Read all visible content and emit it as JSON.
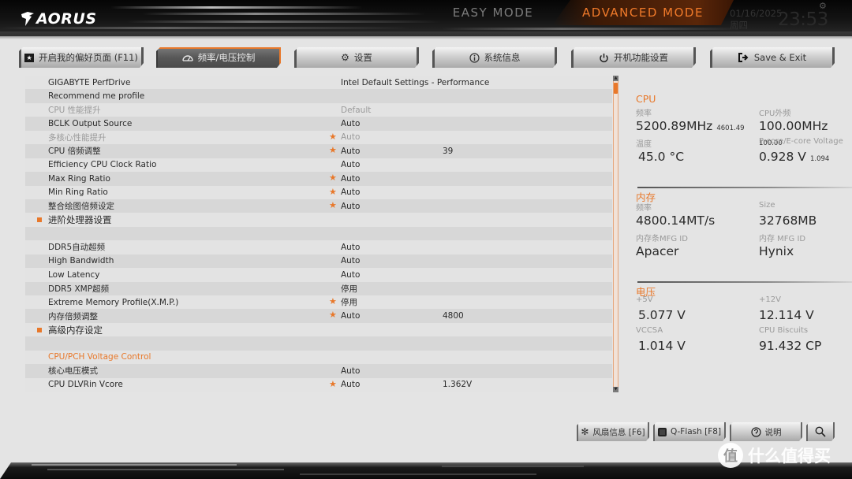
{
  "header": {
    "logo": "AORUS",
    "easy_mode": "EASY MODE",
    "advanced_mode": "ADVANCED MODE",
    "date": "01/16/2025",
    "weekday": "周四",
    "time": "23:53"
  },
  "tabs": [
    {
      "label": "开启我的偏好页面 (F11)",
      "icon": "favorites-icon",
      "active": false
    },
    {
      "label": "频率/电压控制",
      "icon": "speedometer-icon",
      "active": true
    },
    {
      "label": "设置",
      "icon": "gear-icon",
      "active": false
    },
    {
      "label": "系统信息",
      "icon": "info-icon",
      "active": false
    },
    {
      "label": "开机功能设置",
      "icon": "power-icon",
      "active": false
    },
    {
      "label": "Save & Exit",
      "icon": "exit-icon",
      "active": false
    }
  ],
  "settings": [
    {
      "label": "GIGABYTE PerfDrive",
      "value": "Intel Default Settings - Performance",
      "star": false,
      "extra": ""
    },
    {
      "label": "Recommend me profile",
      "value": "",
      "star": false,
      "extra": ""
    },
    {
      "label": "CPU 性能提升",
      "value": "Default",
      "star": false,
      "extra": "",
      "disabled": true
    },
    {
      "label": "BCLK Output Source",
      "value": "Auto",
      "star": false,
      "extra": ""
    },
    {
      "label": "多核心性能提升",
      "value": "Auto",
      "star": true,
      "extra": "",
      "disabled": true
    },
    {
      "label": "CPU 倍频调整",
      "value": "Auto",
      "star": true,
      "extra": "39"
    },
    {
      "label": "Efficiency CPU Clock Ratio",
      "value": "Auto",
      "star": false,
      "extra": ""
    },
    {
      "label": "Max Ring Ratio",
      "value": "Auto",
      "star": true,
      "extra": ""
    },
    {
      "label": "Min Ring Ratio",
      "value": "Auto",
      "star": true,
      "extra": ""
    },
    {
      "label": "整合绘图倍频设定",
      "value": "Auto",
      "star": true,
      "extra": ""
    },
    {
      "label": "进阶处理器设置",
      "value": "",
      "star": false,
      "extra": "",
      "submenu": true
    },
    {
      "label": "",
      "value": "",
      "star": false,
      "extra": ""
    },
    {
      "label": "DDR5自动超频",
      "value": "Auto",
      "star": false,
      "extra": ""
    },
    {
      "label": "High Bandwidth",
      "value": "Auto",
      "star": false,
      "extra": ""
    },
    {
      "label": "Low Latency",
      "value": "Auto",
      "star": false,
      "extra": ""
    },
    {
      "label": "DDR5 XMP超频",
      "value": "停用",
      "star": false,
      "extra": ""
    },
    {
      "label": "Extreme Memory Profile(X.M.P.)",
      "value": "停用",
      "star": true,
      "extra": ""
    },
    {
      "label": "内存倍频调整",
      "value": "Auto",
      "star": true,
      "extra": "4800"
    },
    {
      "label": "高级内存设定",
      "value": "",
      "star": false,
      "extra": "",
      "submenu": true
    },
    {
      "label": "",
      "value": "",
      "star": false,
      "extra": ""
    },
    {
      "label": "CPU/PCH Voltage Control",
      "value": "",
      "star": false,
      "extra": "",
      "section": true
    },
    {
      "label": "核心电压模式",
      "value": "Auto",
      "star": false,
      "extra": ""
    },
    {
      "label": "CPU DLVRin Vcore",
      "value": "Auto",
      "star": true,
      "extra": "1.362V"
    }
  ],
  "scrollbar": {
    "position_fraction": 0.0
  },
  "info": {
    "cpu": {
      "title": "CPU",
      "freq_label": "频率",
      "freq_value": "5200.89MHz",
      "freq_sub": "4601.49",
      "bclk_label": "CPU外频",
      "bclk_value": "100.00MHz",
      "bclk_sub": "100.00",
      "temp_label": "温度",
      "temp_value": "45.0 °C",
      "volt_label": "P-core/E-core Voltage",
      "volt_value": "0.928 V",
      "volt_sub": "1.094"
    },
    "memory": {
      "title": "内存",
      "freq_label": "频率",
      "freq_value": "4800.14MT/s",
      "size_label": "Size",
      "size_value": "32768MB",
      "module_mfg_label": "内存条MFG ID",
      "module_mfg_value": "Apacer",
      "chip_mfg_label": "内存 MFG ID",
      "chip_mfg_value": "Hynix"
    },
    "voltage": {
      "title": "电压",
      "v5_label": "+5V",
      "v5_value": "5.077 V",
      "v12_label": "+12V",
      "v12_value": "12.114 V",
      "vccsa_label": "VCCSA",
      "vccsa_value": "1.014 V",
      "biscuits_label": "CPU Biscuits",
      "biscuits_value": "91.432 CP"
    }
  },
  "bottom_buttons": [
    {
      "label": "风扇信息 [F6]",
      "icon": "fan-icon"
    },
    {
      "label": "Q-Flash [F8]",
      "icon": "qflash-icon"
    },
    {
      "label": "说明",
      "icon": "help-icon"
    },
    {
      "label": "",
      "icon": "search-icon"
    }
  ],
  "watermark": {
    "glyph": "值",
    "text": "什么值得买"
  },
  "colors": {
    "accent": "#e8782a",
    "panel": "#e4e4e4",
    "disabled_text": "#9b9b9b"
  }
}
